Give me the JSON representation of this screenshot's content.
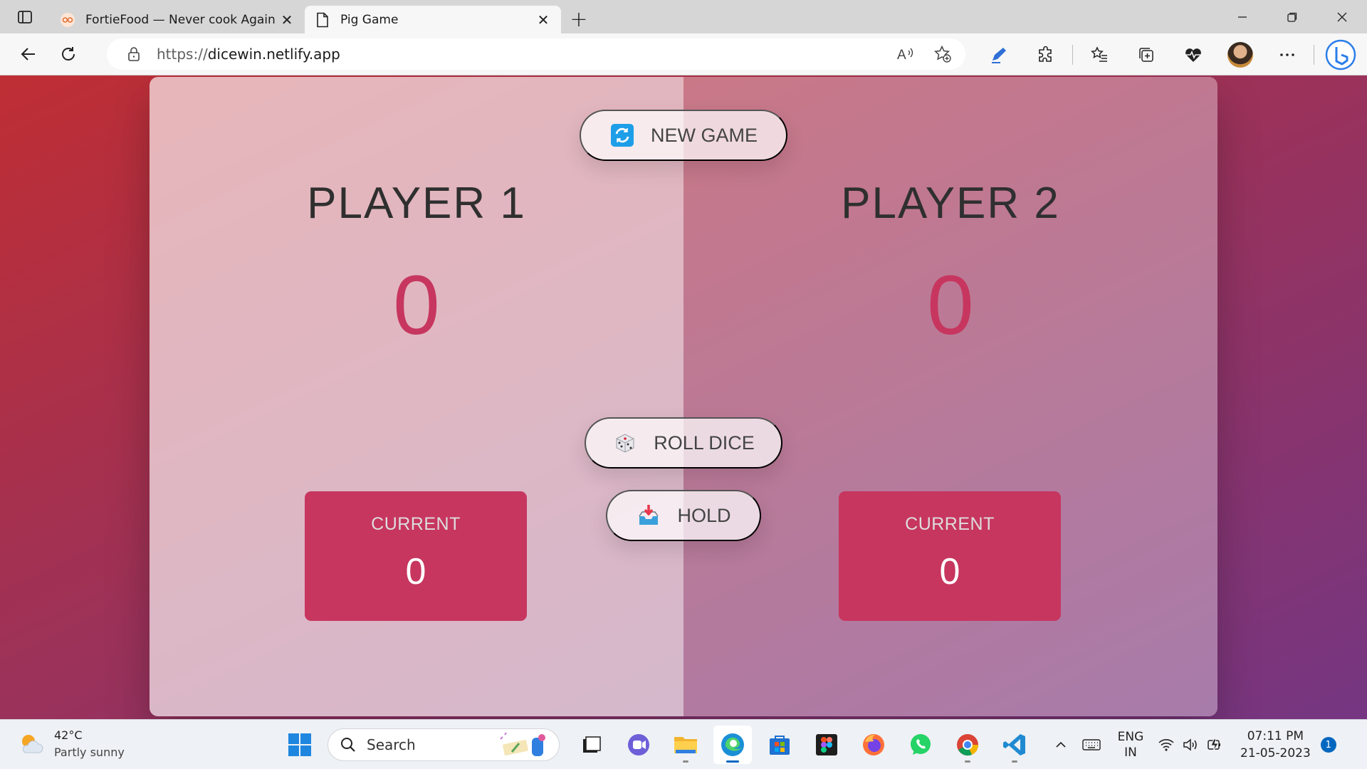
{
  "browser": {
    "tabs": [
      {
        "title": "FortieFood — Never cook Again",
        "active": false
      },
      {
        "title": "Pig Game",
        "active": true
      }
    ],
    "address": {
      "scheme": "https://",
      "host": "dicewin.netlify.app"
    }
  },
  "game": {
    "new_game_label": "NEW GAME",
    "roll_dice_label": "ROLL DICE",
    "hold_label": "HOLD",
    "players": [
      {
        "name": "PLAYER 1",
        "score": "0",
        "current_label": "CURRENT",
        "current_score": "0"
      },
      {
        "name": "PLAYER 2",
        "score": "0",
        "current_label": "CURRENT",
        "current_score": "0"
      }
    ],
    "colors": {
      "accent": "#c7365f",
      "gradient_start": "#bf2e34",
      "gradient_end": "#753682"
    }
  },
  "taskbar": {
    "weather": {
      "temp": "42°C",
      "condition": "Partly sunny"
    },
    "search_label": "Search",
    "language": {
      "line1": "ENG",
      "line2": "IN"
    },
    "clock": {
      "time": "07:11 PM",
      "date": "21-05-2023"
    },
    "notifications": "1",
    "apps": [
      "start-icon",
      "file-explorer-icon",
      "teams-icon",
      "folder-icon",
      "edge-icon",
      "store-icon",
      "figma-icon",
      "firefox-icon",
      "whatsapp-icon",
      "chrome-icon",
      "vscode-icon"
    ]
  }
}
